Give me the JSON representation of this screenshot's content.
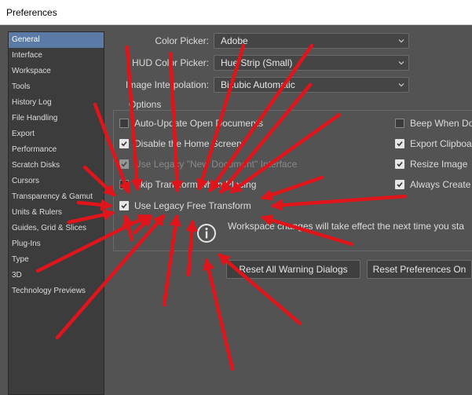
{
  "window": {
    "title": "Preferences"
  },
  "sidebar": {
    "items": [
      {
        "label": "General",
        "active": true
      },
      {
        "label": "Interface"
      },
      {
        "label": "Workspace"
      },
      {
        "label": "Tools"
      },
      {
        "label": "History Log"
      },
      {
        "label": "File Handling"
      },
      {
        "label": "Export"
      },
      {
        "label": "Performance"
      },
      {
        "label": "Scratch Disks"
      },
      {
        "label": "Cursors"
      },
      {
        "label": "Transparency & Gamut"
      },
      {
        "label": "Units & Rulers"
      },
      {
        "label": "Guides, Grid & Slices"
      },
      {
        "label": "Plug-Ins"
      },
      {
        "label": "Type"
      },
      {
        "label": "3D"
      },
      {
        "label": "Technology Previews"
      }
    ]
  },
  "fields": {
    "color_picker": {
      "label": "Color Picker:",
      "value": "Adobe"
    },
    "hud_color_picker": {
      "label": "HUD Color Picker:",
      "value": "Hue Strip (Small)"
    },
    "image_interpolation": {
      "label": "Image Interpolation:",
      "value": "Bicubic Automatic"
    }
  },
  "options": {
    "title": "Options",
    "left": [
      {
        "label": "Auto-Update Open Documents",
        "checked": false,
        "disabled": false
      },
      {
        "label": "Disable the Home Screen",
        "checked": true,
        "disabled": false
      },
      {
        "label": "Use Legacy \"New Document\" Interface",
        "checked": true,
        "disabled": true
      },
      {
        "label": "Skip Transform when Placing",
        "checked": false,
        "disabled": false
      },
      {
        "label": "Use Legacy Free Transform",
        "checked": true,
        "disabled": false
      }
    ],
    "right": [
      {
        "label": "Beep When Do",
        "checked": false
      },
      {
        "label": "Export Clipboa",
        "checked": true
      },
      {
        "label": "Resize Image",
        "checked": true
      },
      {
        "label": "Always Create",
        "checked": true
      }
    ],
    "info_text": "Workspace changes will take effect the next time you sta"
  },
  "buttons": {
    "reset_warnings": "Reset All Warning Dialogs",
    "reset_preferences": "Reset Preferences On"
  },
  "colors": {
    "background": "#535353",
    "sidebar": "#3c3c3c",
    "selection": "#5b7ba6",
    "annotation_arrow": "#e0141b"
  }
}
